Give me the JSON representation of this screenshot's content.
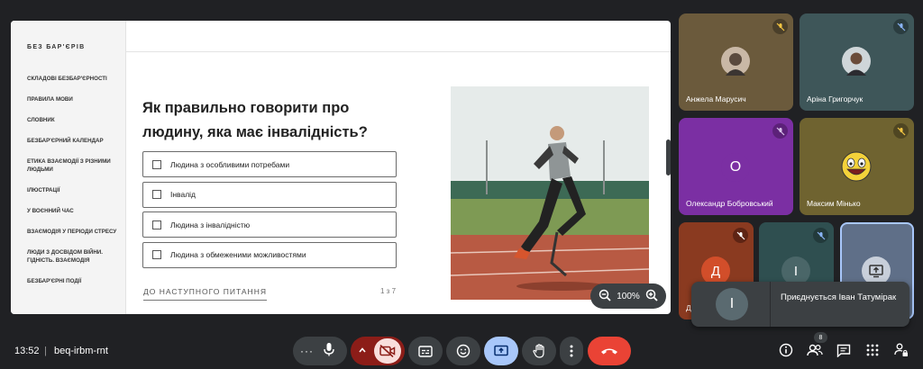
{
  "slide": {
    "brand": "БЕЗ БАР'ЄРІВ",
    "nav": [
      "СКЛАДОВІ БЕЗБАР'ЄРНОСТІ",
      "ПРАВИЛА МОВИ",
      "СЛОВНИК",
      "БЕЗБАР'ЄРНИЙ КАЛЕНДАР",
      "ЕТИКА ВЗАЄМОДІЇ З РІЗНИМИ ЛЮДЬМИ",
      "ІЛЮСТРАЦІЇ",
      "У ВОЄННИЙ ЧАС",
      "ВЗАЄМОДІЯ У ПЕРІОДИ СТРЕСУ",
      "ЛЮДИ З ДОСВІДОМ ВІЙНИ. ГІДНІСТЬ. ВЗАЄМОДІЯ",
      "БЕЗБАР'ЄРНІ ПОДІЇ"
    ],
    "question": "Як правильно говорити про людину, яка має інвалідність?",
    "answers": [
      "Людина з особливими потребами",
      "Інвалід",
      "Людина з інвалідністю",
      "Людина з обмеженими можливостями"
    ],
    "next_label": "ДО НАСТУПНОГО ПИТАННЯ",
    "page_count": "1 з 7",
    "zoom_level": "100%"
  },
  "participants": [
    {
      "name": "Анжела Марусич",
      "bg": "#6b5a3c",
      "mute": "muted"
    },
    {
      "name": "Аріна Григорчук",
      "bg": "#3e5659",
      "mute": "muted-blue"
    },
    {
      "name": "Олександр Бобровський",
      "initial": "О",
      "bg": "#7b2fa3",
      "mute": "muted"
    },
    {
      "name": "Максим Мінько",
      "bg": "#6f6330",
      "mute": "muted"
    },
    {
      "name": "Д",
      "initial": "Д",
      "bg": "#8a3a20"
    },
    {
      "initial": "І",
      "bg": "#2f4f50"
    }
  ],
  "toast": {
    "initial": "І",
    "text": "Приєднується Іван Татумірак"
  },
  "bottombar": {
    "clock": "13:52",
    "separator": "|",
    "meeting_code": "beq-irbm-rnt",
    "people_count": "8"
  },
  "colors": {
    "leave": "#ea4335",
    "accent": "#8ab4f8",
    "muted_red": "#8c1d18"
  }
}
